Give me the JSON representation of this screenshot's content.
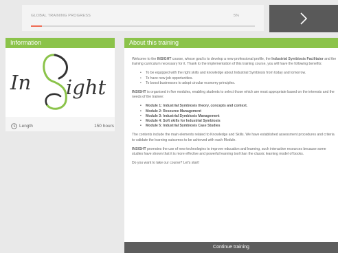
{
  "progress": {
    "label": "GLOBAL TRAINING PROGRESS",
    "percent_text": "5%",
    "percent_value": 5,
    "fill_color": "#ef6b53"
  },
  "next_button": {
    "icon": "chevron-right-icon"
  },
  "info": {
    "title": "Information",
    "logo": {
      "part1": "In",
      "part2": "ight",
      "alt": "INSIGHT"
    },
    "length_label": "Length",
    "length_value": "150 hours"
  },
  "about": {
    "title": "About this training",
    "intro": {
      "t1": "Welcome to the ",
      "b1": "INSIGHT",
      "t2": " course, whose goal is to develop a new professional profile, the ",
      "b2": "Industrial Symbiosis Facilitator",
      "t3": " and the training curriculum necessary for it. Thank to the implementation of this training course, you will have the following benefits:"
    },
    "benefits": [
      "To be equipped with the right skills and knowledge about Industrial Symbiosis from today and tomorrow.",
      "To have new job opportunities.",
      "To boost businesses to adopt circular economy principles."
    ],
    "modules_intro": {
      "b": "INSIGHT",
      "t": " is organised in five modules, enabling students to select those which are most appropriate based on the interests and the needs of the trainee:"
    },
    "modules": [
      "Module 1: Industrial Symbiosis theory, concepts and context.",
      "Module 2: Resource Management",
      "Module 3: Industrial Symbiosis Management",
      "Module 4: Soft skills for Industrial Symbiosis",
      "Module 5: Industrial Symbiosis Case Studies"
    ],
    "contents_text": "The contents include the main elements related to Knowledge and Skills. We have established assessment procedures and criteria to validate the learning outcomes to be achieved with each Module.",
    "promotes": {
      "b": "INSIGHT",
      "t": " promotes the use of new technologies to improve education and learning, such interactive resources because some studies have shown that it is more effective and powerful learning tool than the classic learning model of books."
    },
    "cta_text": "Do you want to take our course? Let's start!",
    "continue_label": "Continue training"
  },
  "colors": {
    "accent_green": "#8bc34a",
    "dark_button": "#595959",
    "progress_fill": "#ef6b53"
  }
}
